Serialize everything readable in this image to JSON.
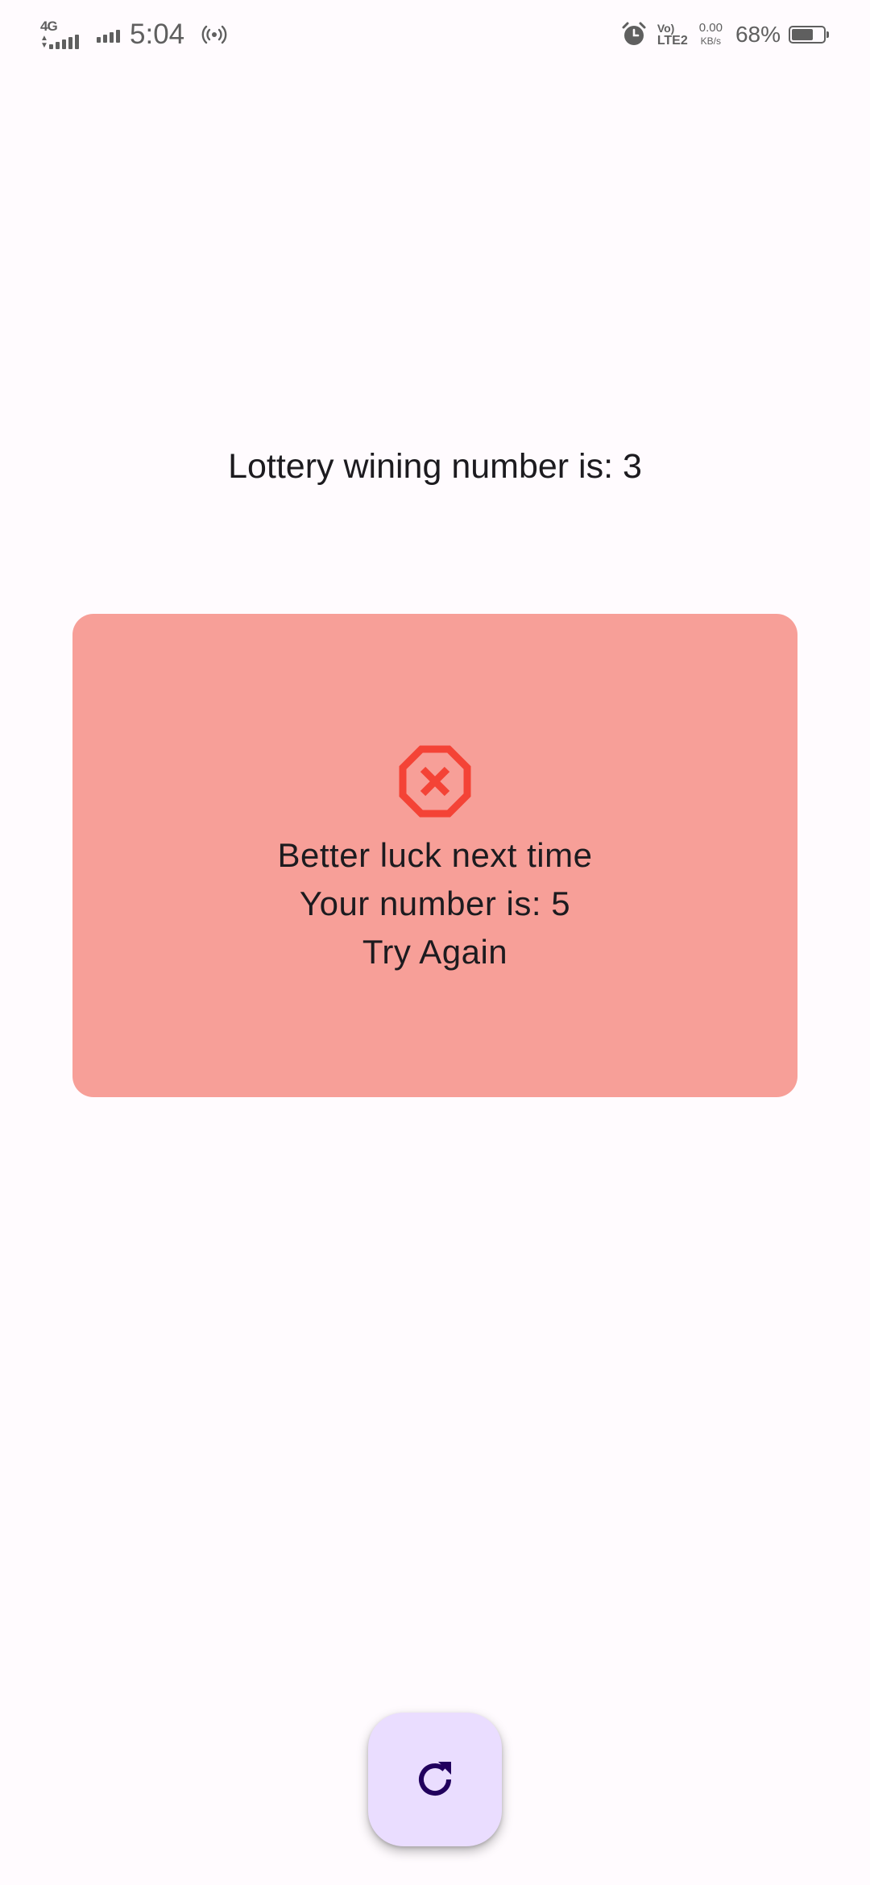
{
  "status_bar": {
    "network_type": "4G",
    "time": "5:04",
    "volte_line1": "Vo)",
    "volte_line2": "LTE2",
    "speed_value": "0.00",
    "speed_unit": "KB/s",
    "battery_percent": "68%",
    "battery_level": 0.68,
    "icons": [
      "signal-4g-icon",
      "signal-icon",
      "hotspot-icon",
      "alarm-icon",
      "volte-icon",
      "battery-icon"
    ]
  },
  "main": {
    "headline": "Lottery wining number is: 3",
    "result_card": {
      "icon": "cancel-octagon-icon",
      "message": "Better luck next time",
      "user_number_text": "Your number is: 5",
      "prompt": "Try Again",
      "background_color": "#f79f98",
      "icon_color": "#f44336"
    }
  },
  "fab": {
    "icon": "refresh-icon",
    "background_color": "#eaddff",
    "icon_color": "#21005d"
  }
}
